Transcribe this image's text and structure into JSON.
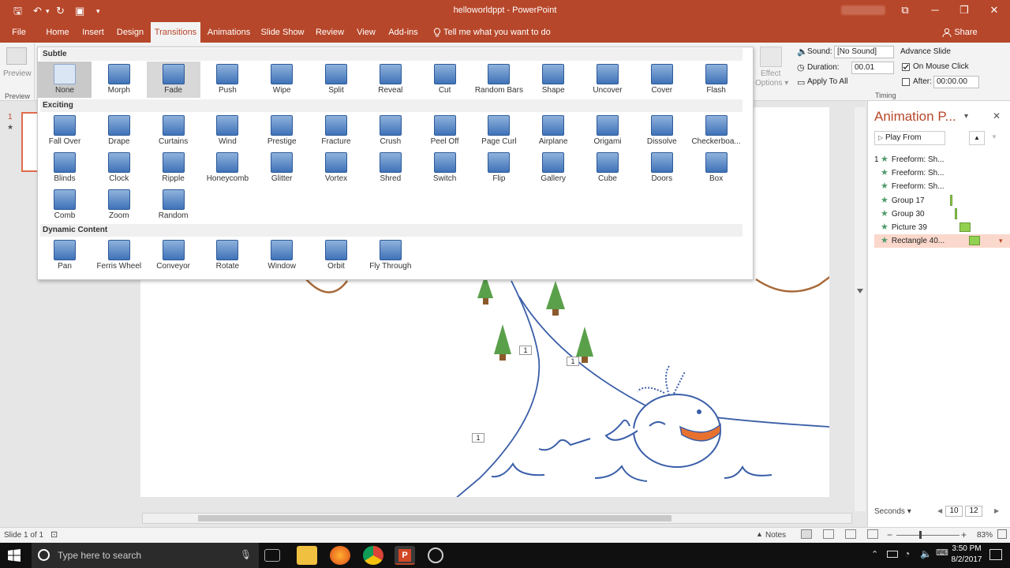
{
  "window": {
    "title": "helloworldppt - PowerPoint",
    "minimize": "─",
    "restore": "❐",
    "close": "✕",
    "ribbon_display": "⧉"
  },
  "qat": {
    "save": "🖫",
    "undo": "↶",
    "undo_dd": "▾",
    "repeat": "↻",
    "present": "▣",
    "customize": "▾"
  },
  "tabs": [
    {
      "label": "File"
    },
    {
      "label": "Home"
    },
    {
      "label": "Insert"
    },
    {
      "label": "Design"
    },
    {
      "label": "Transitions"
    },
    {
      "label": "Animations"
    },
    {
      "label": "Slide Show"
    },
    {
      "label": "Review"
    },
    {
      "label": "View"
    },
    {
      "label": "Add-ins"
    }
  ],
  "tell_me": "Tell me what you want to do",
  "share": "Share",
  "ribbon": {
    "preview_label": "Preview",
    "preview_group": "Preview",
    "effect_options": "Effect\nOptions",
    "effect_line1": "Effect",
    "effect_line2": "Options ▾",
    "sound_label": "Sound:",
    "sound_value": "[No Sound]",
    "duration_label": "Duration:",
    "duration_value": "00.01",
    "apply_all": "Apply To All",
    "advance_slide": "Advance Slide",
    "on_mouse_click": "On Mouse Click",
    "after_label": "After:",
    "after_value": "00:00.00",
    "timing_group": "Timing"
  },
  "gallery": {
    "subtle_title": "Subtle",
    "subtle": [
      "None",
      "Morph",
      "Fade",
      "Push",
      "Wipe",
      "Split",
      "Reveal",
      "Cut",
      "Random Bars",
      "Shape",
      "Uncover",
      "Cover",
      "Flash"
    ],
    "exciting_title": "Exciting",
    "exciting_row1": [
      "Fall Over",
      "Drape",
      "Curtains",
      "Wind",
      "Prestige",
      "Fracture",
      "Crush",
      "Peel Off",
      "Page Curl",
      "Airplane",
      "Origami",
      "Dissolve",
      "Checkerboa..."
    ],
    "exciting_row2": [
      "Blinds",
      "Clock",
      "Ripple",
      "Honeycomb",
      "Glitter",
      "Vortex",
      "Shred",
      "Switch",
      "Flip",
      "Gallery",
      "Cube",
      "Doors",
      "Box"
    ],
    "exciting_row3": [
      "Comb",
      "Zoom",
      "Random"
    ],
    "dynamic_title": "Dynamic Content",
    "dynamic": [
      "Pan",
      "Ferris Wheel",
      "Conveyor",
      "Rotate",
      "Window",
      "Orbit",
      "Fly Through"
    ]
  },
  "slides_pane": {
    "slide_number": "1",
    "slide_star": "★"
  },
  "slide": {
    "tags": [
      "1",
      "1",
      "1"
    ]
  },
  "anim_pane": {
    "title": "Animation P...",
    "play_from": "Play From",
    "items": [
      {
        "num": "1",
        "label": "Freeform: Sh..."
      },
      {
        "num": "",
        "label": "Freeform: Sh..."
      },
      {
        "num": "",
        "label": "Freeform: Sh..."
      },
      {
        "num": "",
        "label": "Group 17"
      },
      {
        "num": "",
        "label": "Group 30"
      },
      {
        "num": "",
        "label": "Picture 39"
      },
      {
        "num": "",
        "label": "Rectangle 40..."
      }
    ],
    "seconds": "Seconds ▾",
    "timeline_a": "10",
    "timeline_b": "12"
  },
  "status": {
    "slide": "Slide 1 of 1",
    "notes": "Notes",
    "zoom": "83%"
  },
  "taskbar": {
    "search": "Type here to search",
    "time": "3:50 PM",
    "date": "8/2/2017"
  },
  "colors": {
    "accent": "#b7472a",
    "selection_row": "#fbd8cc",
    "motion_path": "#3a5ea8",
    "hill": "#a86a3a",
    "tree": "#5aa04a"
  }
}
